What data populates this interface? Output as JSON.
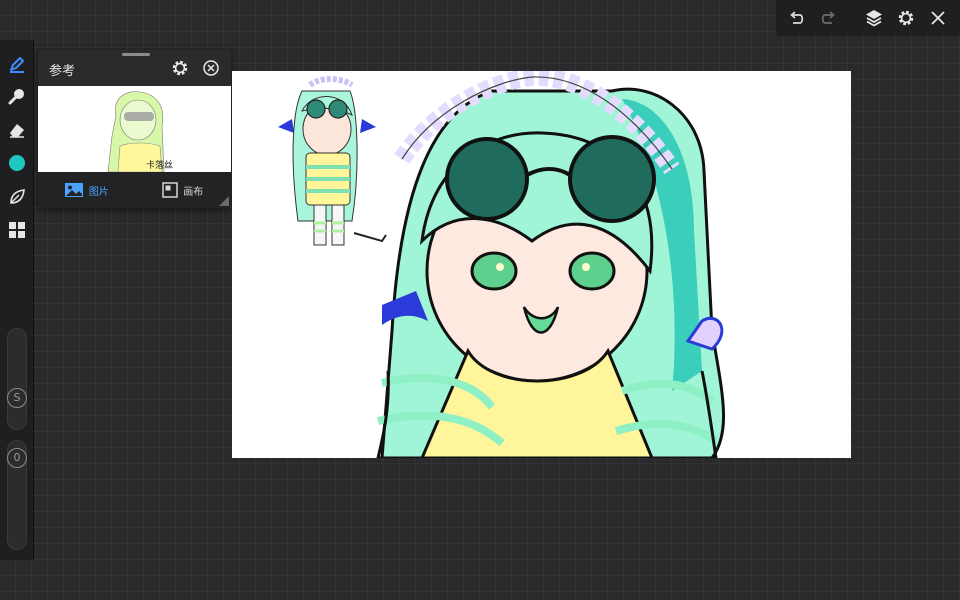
{
  "left_toolbar": {
    "tools": [
      {
        "name": "pen-tool",
        "icon": "pen-icon",
        "active": true
      },
      {
        "name": "brush-tool",
        "icon": "brush-icon"
      },
      {
        "name": "eraser-tool",
        "icon": "eraser-icon"
      },
      {
        "name": "color-tool",
        "icon": "color-swatch-icon",
        "color": "#1ec8c0"
      },
      {
        "name": "leaf-tool",
        "icon": "leaf-icon"
      },
      {
        "name": "grid-tool",
        "icon": "grid-icon"
      }
    ],
    "size_slider_label": "S",
    "opacity_slider_label": "0"
  },
  "top_toolbar": {
    "buttons": [
      "undo-icon",
      "redo-icon",
      "layers-icon",
      "gear-icon",
      "close-icon"
    ]
  },
  "reference_panel": {
    "title": "参考",
    "caption": "卡落丝",
    "tabs": [
      {
        "label": "图片",
        "active": true
      },
      {
        "label": "画布",
        "active": false
      }
    ]
  },
  "colors": {
    "accent": "#4aa3ff",
    "hair": "#9ff5d5",
    "hair_dark": "#22c4b4",
    "sweater_yellow": "#fff59a",
    "sweater_stripe": "#8ff0c6",
    "horn_blue": "#2b3bd9",
    "ruffle": "#e3dcff"
  }
}
